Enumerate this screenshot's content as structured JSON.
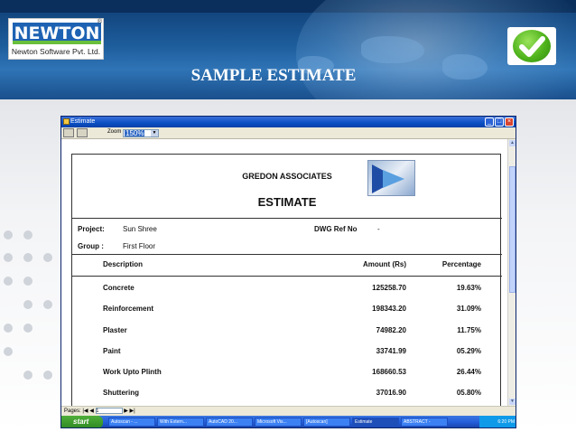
{
  "slide": {
    "title": "SAMPLE ESTIMATE",
    "logo_word": "NEWTON",
    "logo_reg": "®",
    "logo_sub": "Newton Software Pvt. Ltd.",
    "check_icon": "checkmark-icon"
  },
  "window": {
    "title": "Estimate",
    "toolbar": {
      "zoom_label": "Zoom",
      "zoom_value": "150%"
    },
    "pagebar": {
      "label": "Pages:",
      "page_value": "1"
    }
  },
  "document": {
    "company": "GREDON  ASSOCIATES",
    "title": "ESTIMATE",
    "project_label": "Project:",
    "project_value": "Sun Shree",
    "dwg_label": "DWG Ref No",
    "dwg_value": "-",
    "group_label": "Group :",
    "group_value": "First Floor",
    "columns": {
      "description": "Description",
      "amount": "Amount  (Rs)",
      "percentage": "Percentage"
    },
    "rows": [
      {
        "description": "Concrete",
        "amount": "125258.70",
        "percentage": "19.63%"
      },
      {
        "description": "Reinforcement",
        "amount": "198343.20",
        "percentage": "31.09%"
      },
      {
        "description": "Plaster",
        "amount": "74982.20",
        "percentage": "11.75%"
      },
      {
        "description": "Paint",
        "amount": "33741.99",
        "percentage": "05.29%"
      },
      {
        "description": "Work Upto Plinth",
        "amount": "168660.53",
        "percentage": "26.44%"
      },
      {
        "description": "Shuttering",
        "amount": "37016.90",
        "percentage": "05.80%"
      }
    ]
  },
  "taskbar": {
    "start": "start",
    "tasks": [
      "Autoscan - ...",
      "With Extern...",
      "AutoCAD 20...",
      "Microsoft Vis...",
      "[Autoscan]",
      "Estimate",
      "ABSTRACT -"
    ],
    "clock": "6:20 PM"
  },
  "colors": {
    "banner": "#1d5c9b",
    "logo_blue": "#1e63b3",
    "logo_green": "#6abf3a",
    "check_green": "#4fb31c",
    "xp_blue": "#245edb"
  }
}
